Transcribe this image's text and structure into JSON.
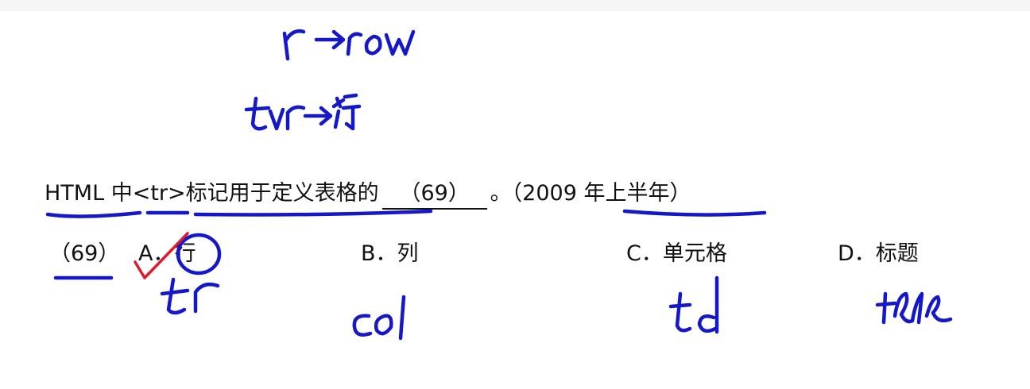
{
  "question": {
    "prefix": "HTML 中<tr>标记用于定义表格的",
    "blank": "（69）",
    "suffix": "。（2009 年上半年）"
  },
  "options": {
    "number": "（69）",
    "a": "A．行",
    "b": "B．列",
    "c": "C．单元格",
    "d": "D．标题"
  },
  "annotations": {
    "note_row": "r → row",
    "note_tr": "tr → 行",
    "under_a": "tr",
    "under_b": "col",
    "under_c": "td",
    "under_d": "title"
  },
  "colors": {
    "ink_blue": "#1518c8",
    "ink_red": "#e01a2c",
    "text": "#111111"
  }
}
